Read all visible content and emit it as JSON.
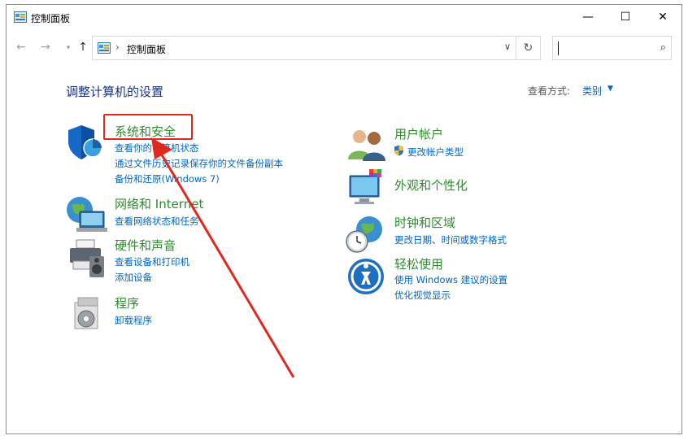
{
  "window": {
    "title": "控制面板",
    "controls": {
      "minimize": "—",
      "maximize": "☐",
      "close": "✕"
    }
  },
  "nav": {
    "back": "←",
    "forward": "→",
    "recent": "▾",
    "up": "↑",
    "address_sep": "›",
    "address_text": "控制面板",
    "address_dropdown": "∨",
    "refresh": "↻",
    "search_placeholder": "",
    "search_icon": "⌕"
  },
  "main": {
    "heading": "调整计算机的设置",
    "view_by_label": "查看方式:",
    "view_by_value": "类别",
    "view_by_arrow": "▼"
  },
  "categories_left": [
    {
      "title": "系统和安全",
      "links": [
        "查看你的计算机状态",
        "通过文件历史记录保存你的文件备份副本",
        "备份和还原(Windows 7)"
      ]
    },
    {
      "title": "网络和 Internet",
      "links": [
        "查看网络状态和任务"
      ]
    },
    {
      "title": "硬件和声音",
      "links": [
        "查看设备和打印机",
        "添加设备"
      ]
    },
    {
      "title": "程序",
      "links": [
        "卸载程序"
      ]
    }
  ],
  "categories_right": [
    {
      "title": "用户帐户",
      "links": [
        "更改帐户类型"
      ]
    },
    {
      "title": "外观和个性化",
      "links": []
    },
    {
      "title": "时钟和区域",
      "links": [
        "更改日期、时间或数字格式"
      ]
    },
    {
      "title": "轻松使用",
      "links": [
        "使用 Windows 建议的设置",
        "优化视觉显示"
      ]
    }
  ],
  "colors": {
    "heading": "#1e3287",
    "category_title": "#2e8b2e",
    "link": "#0066cc",
    "annotation": "#e0281e"
  }
}
